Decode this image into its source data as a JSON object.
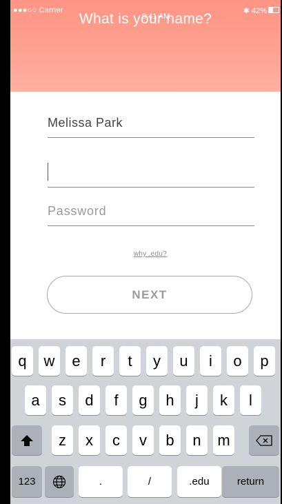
{
  "status_bar": {
    "carrier": "●●●○○ Carrier",
    "time": "9:41 AM",
    "battery": "42%",
    "wifi_icon": "wifi-icon",
    "bluetooth_icon": "bluetooth-icon"
  },
  "header": {
    "title": "What is your name?"
  },
  "form": {
    "name_value": "Melissa Park",
    "email_value": "",
    "password_placeholder": "Password",
    "why_link": "why .edu?",
    "next_label": "NEXT"
  },
  "keyboard": {
    "row1": [
      "q",
      "w",
      "e",
      "r",
      "t",
      "y",
      "u",
      "i",
      "o",
      "p"
    ],
    "row2": [
      "a",
      "s",
      "d",
      "f",
      "g",
      "h",
      "j",
      "k",
      "l"
    ],
    "row3": [
      "z",
      "x",
      "c",
      "v",
      "b",
      "n",
      "m"
    ],
    "numbers_label": "123",
    "dot_label": ".",
    "slash_label": "/",
    "edu_label": ".edu",
    "return_label": "return",
    "shift_icon": "shift-icon",
    "globe_icon": "globe-icon",
    "backspace_icon": "backspace-icon"
  }
}
